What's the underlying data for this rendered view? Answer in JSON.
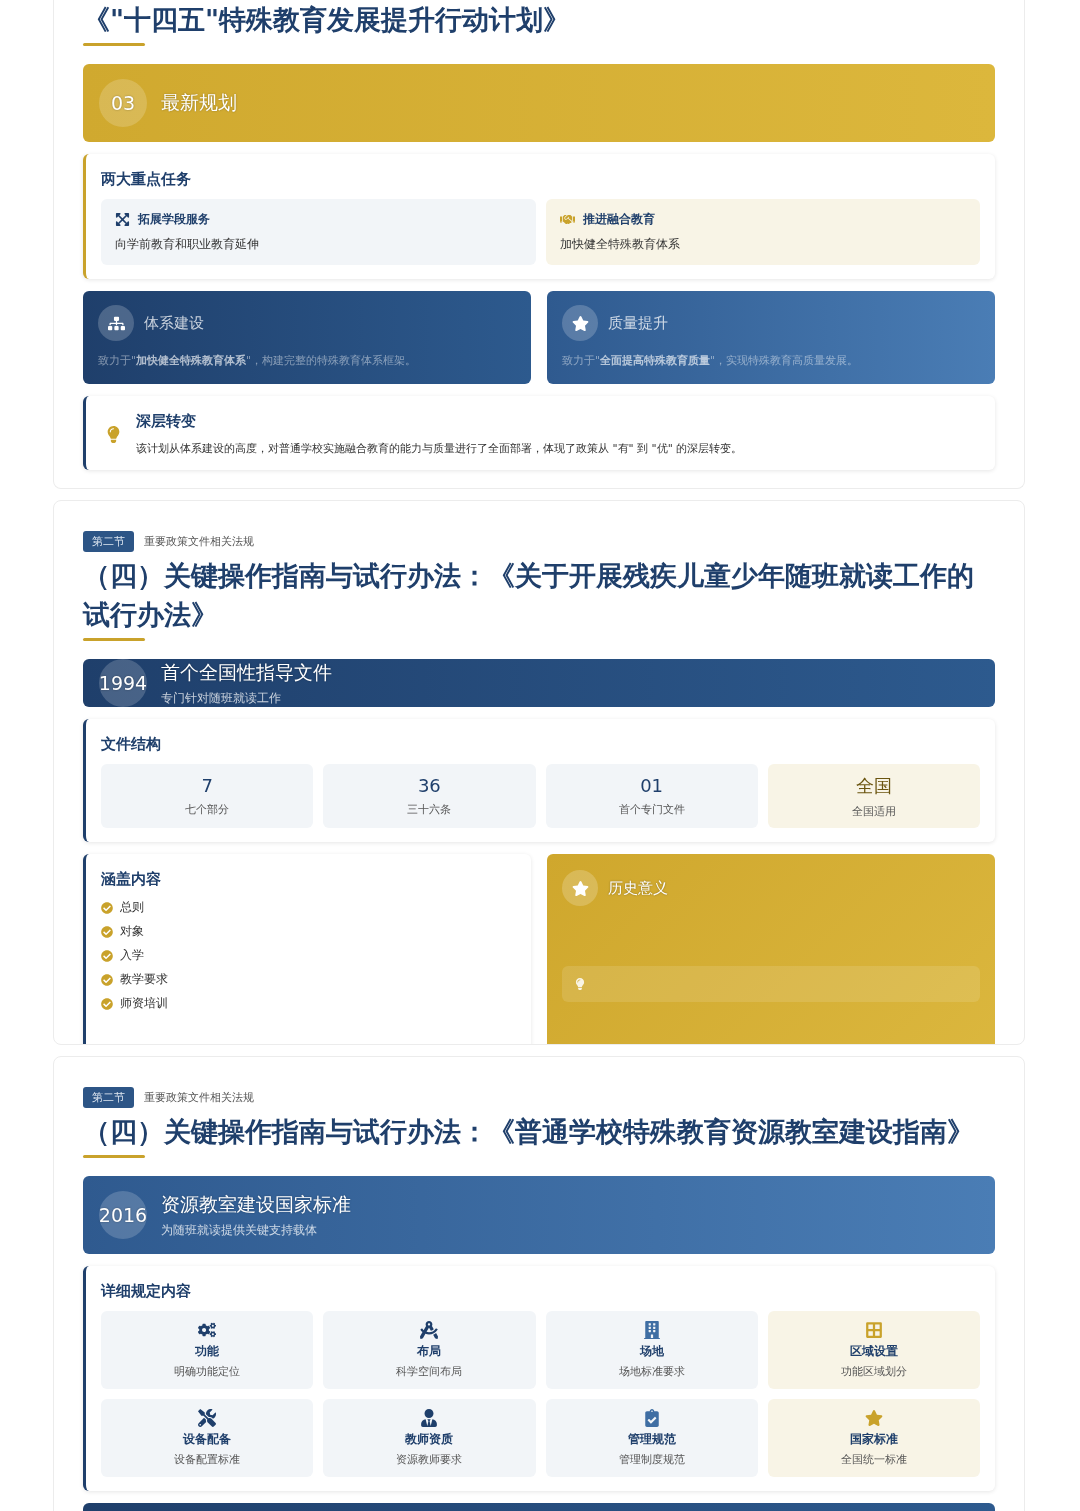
{
  "sections": [
    {
      "title": "《\"十四五\"特殊教育发展提升行动计划》",
      "banner": {
        "kind": "gold",
        "number": "03",
        "heading": "最新规划"
      },
      "blocks": [
        {
          "kind": "tasks",
          "title": "两大重点任务",
          "items": [
            {
              "kind": "plain",
              "title": "拓展学段服务",
              "text": "向学前教育和职业教育延伸"
            },
            {
              "kind": "highlight",
              "title": "推进融合教育",
              "text": "加快健全特殊教育体系"
            }
          ]
        },
        {
          "kind": "pair",
          "cards": [
            {
              "kind": "navy",
              "title": "体系建设",
              "text": "致力于\"**加快健全特殊教育体系**\"，构建完整的特殊教育体系框架。"
            },
            {
              "kind": "blue",
              "title": "质量提升",
              "text": "致力于\"**全面提高特殊教育质量**\"，实现特殊教育高质量发展。"
            }
          ]
        },
        {
          "kind": "note",
          "title": "深层转变",
          "text": "该计划从体系建设的高度，对普通学校实施融合教育的能力与质量进行了全面部署，体现了政策从 \"有\" 到 \"优\" 的深层转变。"
        }
      ]
    },
    {
      "badge": "第二节",
      "caption": "重要政策文件相关法规",
      "title": "（四）关键操作指南与试行办法：《关于开展残疾儿童少年随班就读工作的试行办法》",
      "banner": {
        "kind": "navy",
        "number": "1994",
        "heading": "首个全国性指导文件",
        "subtitle": "专门针对随班就读工作"
      },
      "blocks": [
        {
          "kind": "stats",
          "title": "文件结构",
          "items": [
            {
              "kind": "plain",
              "value": "7",
              "label": "七个部分"
            },
            {
              "kind": "plain",
              "value": "36",
              "label": "三十六条"
            },
            {
              "kind": "plain",
              "value": "01",
              "label": "首个专门文件"
            },
            {
              "kind": "highlight",
              "value": "全国",
              "label": "全国适用"
            }
          ]
        },
        {
          "kind": "split",
          "list_title": "涵盖内容",
          "list": [
            "总则",
            "对象",
            "入学",
            "教学要求",
            "师资培训"
          ],
          "feature": {
            "title": "历史意义"
          }
        }
      ]
    },
    {
      "badge": "第二节",
      "caption": "重要政策文件相关法规",
      "title": "（四）关键操作指南与试行办法：《普通学校特殊教育资源教室建设指南》",
      "banner": {
        "kind": "blue",
        "number": "2016",
        "heading": "资源教室建设国家标准",
        "subtitle": "为随班就读提供关键支持载体"
      },
      "blocks": [
        {
          "kind": "grid",
          "title": "详细规定内容",
          "items": [
            {
              "kind": "plain",
              "title": "功能",
              "text": "明确功能定位"
            },
            {
              "kind": "plain",
              "title": "布局",
              "text": "科学空间布局"
            },
            {
              "kind": "plain",
              "title": "场地",
              "text": "场地标准要求"
            },
            {
              "kind": "highlight",
              "title": "区域设置",
              "text": "功能区域划分"
            },
            {
              "kind": "plain",
              "title": "设备配备",
              "text": "设备配置标准"
            },
            {
              "kind": "plain",
              "title": "教师资质",
              "text": "资源教师要求"
            },
            {
              "kind": "plain",
              "title": "管理规范",
              "text": "管理制度规范"
            },
            {
              "kind": "highlight",
              "title": "国家标准",
              "text": "全国统一标准"
            }
          ]
        },
        {
          "kind": "bar"
        }
      ]
    }
  ]
}
